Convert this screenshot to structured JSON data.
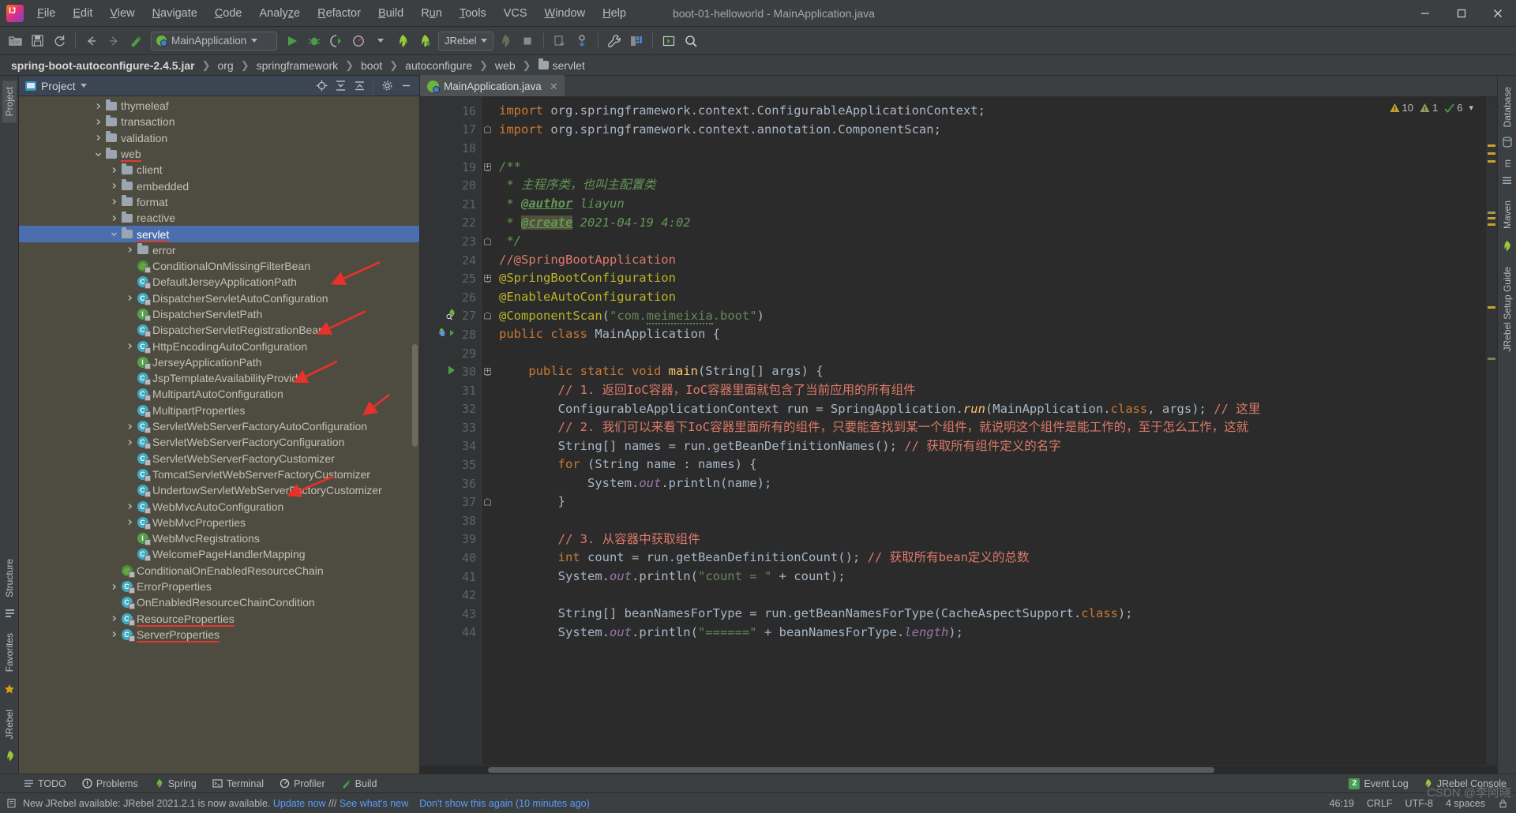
{
  "window": {
    "title": "boot-01-helloworld - MainApplication.java",
    "app_logo": "intellij-idea-logo"
  },
  "menubar": [
    {
      "label": "File",
      "mnemonic": "F"
    },
    {
      "label": "Edit",
      "mnemonic": "E"
    },
    {
      "label": "View",
      "mnemonic": "V"
    },
    {
      "label": "Navigate",
      "mnemonic": "N"
    },
    {
      "label": "Code",
      "mnemonic": "C"
    },
    {
      "label": "Analyze",
      "mnemonic": "z"
    },
    {
      "label": "Refactor",
      "mnemonic": "R"
    },
    {
      "label": "Build",
      "mnemonic": "B"
    },
    {
      "label": "Run",
      "mnemonic": "u"
    },
    {
      "label": "Tools",
      "mnemonic": "T"
    },
    {
      "label": "VCS",
      "mnemonic": ""
    },
    {
      "label": "Window",
      "mnemonic": "W"
    },
    {
      "label": "Help",
      "mnemonic": "H"
    }
  ],
  "toolbar": {
    "run_configuration": "MainApplication",
    "jrebel_label": "JRebel",
    "icons": [
      "open-folder-icon",
      "save-all-icon",
      "sync-icon",
      "back-icon",
      "forward-icon",
      "build-icon",
      "run-icon",
      "debug-icon",
      "run-coverage-icon",
      "profile-icon",
      "jrebel-run-icon",
      "jrebel-debug-icon",
      "stop-icon-disabled",
      "stop-square-icon",
      "update-project-icon",
      "commit-icon",
      "settings-wrench-icon",
      "project-structure-icon",
      "select-in-icon",
      "search-everywhere-icon"
    ]
  },
  "breadcrumb": {
    "items": [
      "spring-boot-autoconfigure-2.4.5.jar",
      "org",
      "springframework",
      "boot",
      "autoconfigure",
      "web",
      "servlet"
    ],
    "last_is_folder": true
  },
  "left_rail": {
    "top_tabs": [
      "Project"
    ],
    "bottom_tabs": [
      "Structure",
      "Favorites",
      "JRebel"
    ]
  },
  "right_rail": {
    "tabs": [
      "Database",
      "m",
      "Maven",
      "JRebel Setup Guide"
    ]
  },
  "project_panel": {
    "header_title": "Project",
    "header_icon": "project-view-icon",
    "action_icons": [
      "locate-icon",
      "expand-all-icon",
      "collapse-all-icon",
      "settings-gear-icon",
      "hide-icon"
    ],
    "tree": [
      {
        "label": "thymeleaf",
        "indent": 1,
        "arrow": "right",
        "icon": "folder",
        "underline": false
      },
      {
        "label": "transaction",
        "indent": 1,
        "arrow": "right",
        "icon": "folder",
        "underline": false
      },
      {
        "label": "validation",
        "indent": 1,
        "arrow": "right",
        "icon": "folder",
        "underline": false
      },
      {
        "label": "web",
        "indent": 1,
        "arrow": "down",
        "icon": "folder",
        "underline": true
      },
      {
        "label": "client",
        "indent": 2,
        "arrow": "right",
        "icon": "folder",
        "underline": false
      },
      {
        "label": "embedded",
        "indent": 2,
        "arrow": "right",
        "icon": "folder",
        "underline": false
      },
      {
        "label": "format",
        "indent": 2,
        "arrow": "right",
        "icon": "folder",
        "underline": false
      },
      {
        "label": "reactive",
        "indent": 2,
        "arrow": "right",
        "icon": "folder",
        "underline": false
      },
      {
        "label": "servlet",
        "indent": 2,
        "arrow": "down",
        "icon": "folder",
        "underline": true,
        "selected": true
      },
      {
        "label": "error",
        "indent": 3,
        "arrow": "right",
        "icon": "folder",
        "underline": false
      },
      {
        "label": "ConditionalOnMissingFilterBean",
        "indent": 3,
        "arrow": "none",
        "icon": "annotation",
        "underline": false
      },
      {
        "label": "DefaultJerseyApplicationPath",
        "indent": 3,
        "arrow": "none",
        "icon": "class",
        "underline": false
      },
      {
        "label": "DispatcherServletAutoConfiguration",
        "indent": 3,
        "arrow": "right",
        "icon": "class",
        "underline": false
      },
      {
        "label": "DispatcherServletPath",
        "indent": 3,
        "arrow": "none",
        "icon": "interface",
        "underline": false
      },
      {
        "label": "DispatcherServletRegistrationBean",
        "indent": 3,
        "arrow": "none",
        "icon": "class",
        "underline": false
      },
      {
        "label": "HttpEncodingAutoConfiguration",
        "indent": 3,
        "arrow": "right",
        "icon": "class",
        "underline": false
      },
      {
        "label": "JerseyApplicationPath",
        "indent": 3,
        "arrow": "none",
        "icon": "interface",
        "underline": false
      },
      {
        "label": "JspTemplateAvailabilityProvider",
        "indent": 3,
        "arrow": "none",
        "icon": "class",
        "underline": false
      },
      {
        "label": "MultipartAutoConfiguration",
        "indent": 3,
        "arrow": "none",
        "icon": "class",
        "underline": false
      },
      {
        "label": "MultipartProperties",
        "indent": 3,
        "arrow": "none",
        "icon": "class",
        "underline": false
      },
      {
        "label": "ServletWebServerFactoryAutoConfiguration",
        "indent": 3,
        "arrow": "right",
        "icon": "class",
        "underline": false
      },
      {
        "label": "ServletWebServerFactoryConfiguration",
        "indent": 3,
        "arrow": "right",
        "icon": "class",
        "underline": false
      },
      {
        "label": "ServletWebServerFactoryCustomizer",
        "indent": 3,
        "arrow": "none",
        "icon": "class",
        "underline": false
      },
      {
        "label": "TomcatServletWebServerFactoryCustomizer",
        "indent": 3,
        "arrow": "none",
        "icon": "class",
        "underline": false
      },
      {
        "label": "UndertowServletWebServerFactoryCustomizer",
        "indent": 3,
        "arrow": "none",
        "icon": "class",
        "underline": false
      },
      {
        "label": "WebMvcAutoConfiguration",
        "indent": 3,
        "arrow": "right",
        "icon": "class",
        "underline": false
      },
      {
        "label": "WebMvcProperties",
        "indent": 3,
        "arrow": "right",
        "icon": "class",
        "underline": false
      },
      {
        "label": "WebMvcRegistrations",
        "indent": 3,
        "arrow": "none",
        "icon": "interface",
        "underline": false
      },
      {
        "label": "WelcomePageHandlerMapping",
        "indent": 3,
        "arrow": "none",
        "icon": "class",
        "underline": false
      },
      {
        "label": "ConditionalOnEnabledResourceChain",
        "indent": 2,
        "arrow": "none",
        "icon": "annotation",
        "underline": false
      },
      {
        "label": "ErrorProperties",
        "indent": 2,
        "arrow": "right",
        "icon": "class",
        "underline": false
      },
      {
        "label": "OnEnabledResourceChainCondition",
        "indent": 2,
        "arrow": "none",
        "icon": "class",
        "underline": false
      },
      {
        "label": "ResourceProperties",
        "indent": 2,
        "arrow": "right",
        "icon": "class",
        "underline": true
      },
      {
        "label": "ServerProperties",
        "indent": 2,
        "arrow": "right",
        "icon": "class",
        "underline": true
      }
    ],
    "annotation_arrows": [
      {
        "target": "DispatcherServletAutoConfiguration"
      },
      {
        "target": "HttpEncodingAutoConfiguration"
      },
      {
        "target": "MultipartAutoConfiguration"
      },
      {
        "target": "ServletWebServerFactoryAutoConfiguration"
      },
      {
        "target": "WebMvcAutoConfiguration"
      }
    ]
  },
  "editor": {
    "tab": {
      "label": "MainApplication.java",
      "icon": "spring-boot-class-icon",
      "close_icon": "close-icon"
    },
    "inspections": {
      "warnings": "10",
      "weak_warnings": "1",
      "typos": "6",
      "chevron": "chevron-down-icon"
    },
    "first_line_number": 16,
    "lines": [
      {
        "n": 16,
        "segs": [
          {
            "t": "import ",
            "c": "kw"
          },
          {
            "t": "org.springframework.context.ConfigurableApplicationContext;",
            "c": "txt"
          }
        ]
      },
      {
        "n": 17,
        "fold": "end",
        "segs": [
          {
            "t": "import ",
            "c": "kw"
          },
          {
            "t": "org.springframework.context.annotation.ComponentScan;",
            "c": "txt"
          }
        ]
      },
      {
        "n": 18,
        "segs": []
      },
      {
        "n": 19,
        "fold": "start",
        "segs": [
          {
            "t": "/**",
            "c": "jdoc"
          }
        ]
      },
      {
        "n": 20,
        "segs": [
          {
            "t": " * ",
            "c": "jdoc"
          },
          {
            "t": "主程序类，也叫主配置类",
            "c": "jdoc"
          }
        ]
      },
      {
        "n": 21,
        "segs": [
          {
            "t": " * ",
            "c": "jdoc"
          },
          {
            "t": "@author",
            "c": "jdoc-tag"
          },
          {
            "t": " liayun",
            "c": "jdoc"
          }
        ]
      },
      {
        "n": 22,
        "segs": [
          {
            "t": " * ",
            "c": "jdoc"
          },
          {
            "t": "@create",
            "c": "jdoc-tag jdoc-hl"
          },
          {
            "t": " 2021-04-19 4:02",
            "c": "jdoc"
          }
        ]
      },
      {
        "n": 23,
        "fold": "end",
        "segs": [
          {
            "t": " */",
            "c": "jdoc"
          }
        ]
      },
      {
        "n": 24,
        "segs": [
          {
            "t": "//@SpringBootApplication",
            "c": "cmt-red"
          }
        ]
      },
      {
        "n": 25,
        "fold": "start",
        "segs": [
          {
            "t": "@SpringBootConfiguration",
            "c": "ann"
          }
        ]
      },
      {
        "n": 26,
        "segs": [
          {
            "t": "@EnableAutoConfiguration",
            "c": "ann"
          }
        ]
      },
      {
        "n": 27,
        "gutter_icon": "bean-search-icon",
        "fold": "end",
        "segs": [
          {
            "t": "@ComponentScan",
            "c": "ann"
          },
          {
            "t": "(",
            "c": "txt"
          },
          {
            "t": "\"com.",
            "c": "str"
          },
          {
            "t": "meimeixia",
            "c": "str wavy"
          },
          {
            "t": ".boot\"",
            "c": "str"
          },
          {
            "t": ")",
            "c": "txt"
          }
        ]
      },
      {
        "n": 28,
        "gutter_icon": "spring-bean-run-icon",
        "segs": [
          {
            "t": "public class ",
            "c": "kw"
          },
          {
            "t": "MainApplication ",
            "c": "txt"
          },
          {
            "t": "{",
            "c": "txt"
          }
        ]
      },
      {
        "n": 29,
        "segs": []
      },
      {
        "n": 30,
        "gutter_icon": "run-method-icon",
        "fold": "start",
        "segs": [
          {
            "t": "    public static void ",
            "c": "kw"
          },
          {
            "t": "main",
            "c": "mtd"
          },
          {
            "t": "(String[] args) {",
            "c": "txt"
          }
        ]
      },
      {
        "n": 31,
        "segs": [
          {
            "t": "        // 1. 返回IoC容器，IoC容器里面就包含了当前应用的所有组件",
            "c": "cmt-red"
          }
        ]
      },
      {
        "n": 32,
        "segs": [
          {
            "t": "        ConfigurableApplicationContext run = SpringApplication.",
            "c": "txt"
          },
          {
            "t": "run",
            "c": "mtd-i"
          },
          {
            "t": "(MainApplication.",
            "c": "txt"
          },
          {
            "t": "class",
            "c": "kw"
          },
          {
            "t": ", args); ",
            "c": "txt"
          },
          {
            "t": "// 这里",
            "c": "cmt-red"
          }
        ]
      },
      {
        "n": 33,
        "segs": [
          {
            "t": "        // 2. 我们可以来看下IoC容器里面所有的组件，只要能查找到某一个组件，就说明这个组件是能工作的，至于怎么工作，这就",
            "c": "cmt-red"
          }
        ]
      },
      {
        "n": 34,
        "segs": [
          {
            "t": "        String[] names = run.getBeanDefinitionNames(); ",
            "c": "txt"
          },
          {
            "t": "// 获取所有组件定义的名字",
            "c": "cmt-red"
          }
        ]
      },
      {
        "n": 35,
        "segs": [
          {
            "t": "        for ",
            "c": "kw"
          },
          {
            "t": "(String name : names) {",
            "c": "txt"
          }
        ]
      },
      {
        "n": 36,
        "segs": [
          {
            "t": "            System.",
            "c": "txt"
          },
          {
            "t": "out",
            "c": "fld"
          },
          {
            "t": ".println(name);",
            "c": "txt"
          }
        ]
      },
      {
        "n": 37,
        "fold": "end",
        "segs": [
          {
            "t": "        }",
            "c": "txt"
          }
        ]
      },
      {
        "n": 38,
        "segs": []
      },
      {
        "n": 39,
        "segs": [
          {
            "t": "        // 3. 从容器中获取组件",
            "c": "cmt-red"
          }
        ]
      },
      {
        "n": 40,
        "segs": [
          {
            "t": "        int ",
            "c": "kw"
          },
          {
            "t": "count = run.getBeanDefinitionCount(); ",
            "c": "txt"
          },
          {
            "t": "// 获取所有bean定义的总数",
            "c": "cmt-red"
          }
        ]
      },
      {
        "n": 41,
        "segs": [
          {
            "t": "        System.",
            "c": "txt"
          },
          {
            "t": "out",
            "c": "fld"
          },
          {
            "t": ".println(",
            "c": "txt"
          },
          {
            "t": "\"count = \"",
            "c": "str"
          },
          {
            "t": " + count);",
            "c": "txt"
          }
        ]
      },
      {
        "n": 42,
        "segs": []
      },
      {
        "n": 43,
        "segs": [
          {
            "t": "        String[] beanNamesForType = run.getBeanNamesForType(CacheAspectSupport.",
            "c": "txt"
          },
          {
            "t": "class",
            "c": "kw"
          },
          {
            "t": ");",
            "c": "txt"
          }
        ]
      },
      {
        "n": 44,
        "segs": [
          {
            "t": "        System.",
            "c": "txt"
          },
          {
            "t": "out",
            "c": "fld"
          },
          {
            "t": ".println(",
            "c": "txt"
          },
          {
            "t": "\"======\"",
            "c": "str"
          },
          {
            "t": " + beanNamesForType.",
            "c": "txt"
          },
          {
            "t": "length",
            "c": "fld"
          },
          {
            "t": ");",
            "c": "txt"
          }
        ]
      }
    ]
  },
  "tool_windows": {
    "left": [
      {
        "label": "TODO",
        "icon": "todo-icon"
      },
      {
        "label": "Problems",
        "icon": "problems-icon"
      },
      {
        "label": "Spring",
        "icon": "spring-leaf-icon"
      },
      {
        "label": "Terminal",
        "icon": "terminal-icon"
      },
      {
        "label": "Profiler",
        "icon": "profiler-icon"
      },
      {
        "label": "Build",
        "icon": "build-hammer-icon"
      }
    ],
    "right": [
      {
        "label": "Event Log",
        "icon": "event-log-icon",
        "badge": "2"
      },
      {
        "label": "JRebel Console",
        "icon": "jrebel-icon"
      }
    ]
  },
  "status_bar": {
    "icon": "notification-icon",
    "message_prefix": "New JRebel available: JRebel 2021.2.1 is now available.",
    "link_update": "Update now",
    "separator": "///",
    "link_whatsnew": "See what's new",
    "dismiss": "Don't show this again (10 minutes ago)",
    "caret_position": "46:19",
    "line_separator": "CRLF",
    "encoding": "UTF-8",
    "indent": "4 spaces",
    "lock_icon": "lock-icon"
  },
  "watermark": "CSDN @李阿晓",
  "colors": {
    "accent_blue": "#4b6eaf",
    "tree_bg": "#4e4b41",
    "editor_bg": "#2b2b2b",
    "chrome_bg": "#3c3f41",
    "arrow_red": "#e8312a",
    "warning_yellow": "#c9a227"
  }
}
